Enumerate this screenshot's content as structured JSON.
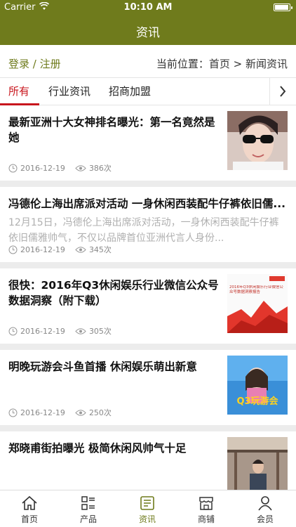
{
  "status": {
    "carrier": "Carrier",
    "time": "10:10 AM"
  },
  "nav": {
    "title": "资讯"
  },
  "crumb": {
    "login": "登录",
    "sep": " / ",
    "register": "注册",
    "location": "当前位置：首页 > 新闻资讯"
  },
  "tabs": [
    {
      "label": "所有",
      "active": true
    },
    {
      "label": "行业资讯",
      "active": false
    },
    {
      "label": "招商加盟",
      "active": false
    }
  ],
  "articles": [
    {
      "title": "最新亚洲十大女神排名曝光：第一名竟然是她",
      "date": "2016-12-19",
      "views": "386次",
      "thumb": "woman-sunglasses-photo"
    },
    {
      "title": "冯德伦上海出席派对活动 一身休闲西装配牛仔裤依旧儒...",
      "summary": "12月15日，冯德伦上海出席派对活动，一身休闲西装配牛仔裤依旧儒雅帅气，不仅以品牌首位亚洲代言人身份...",
      "date": "2016-12-19",
      "views": "345次"
    },
    {
      "title": "很快：2016年Q3休闲娱乐行业微信公众号数据洞察（附下载）",
      "date": "2016-12-19",
      "views": "305次",
      "thumb": "report-cover",
      "thumb_text": "2016年Q3休闲娱乐行业微信公众号数据洞察报告"
    },
    {
      "title": "明晚玩游会斗鱼首播 休闲娱乐萌出新意",
      "date": "2016-12-19",
      "views": "250次",
      "thumb": "game-show-poster",
      "thumb_text": "Q3玩游会"
    },
    {
      "title": "郑晓甫街拍曝光 极简休闲风帅气十足",
      "date": "",
      "views": "",
      "thumb": "street-photo"
    }
  ],
  "tabbar": [
    {
      "label": "首页",
      "icon": "home-icon",
      "active": false
    },
    {
      "label": "产品",
      "icon": "product-list-icon",
      "active": false
    },
    {
      "label": "资讯",
      "icon": "news-icon",
      "active": true
    },
    {
      "label": "商铺",
      "icon": "shop-icon",
      "active": false
    },
    {
      "label": "会员",
      "icon": "member-icon",
      "active": false
    }
  ],
  "colors": {
    "brand": "#6f7b1c",
    "accent": "#c8161d"
  }
}
